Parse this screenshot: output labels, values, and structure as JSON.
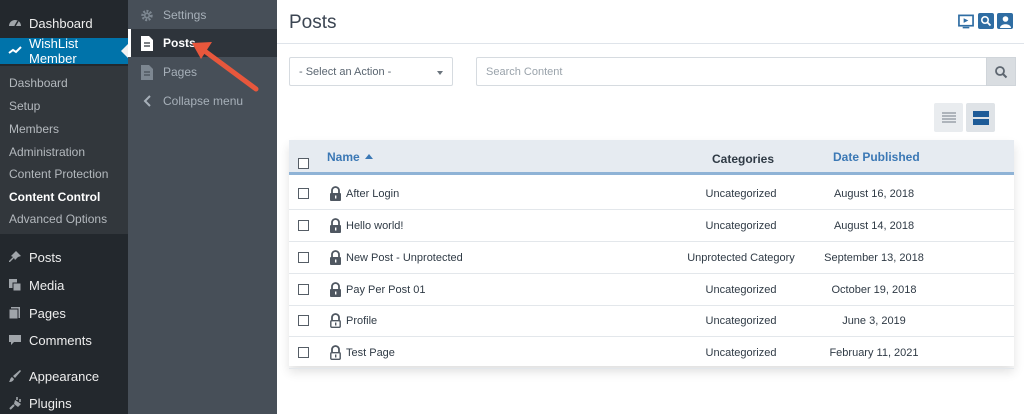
{
  "wp_menu": {
    "items_top": [
      {
        "label": "Dashboard",
        "icon": "dashboard-icon"
      },
      {
        "label": "WishList Member",
        "icon": "wishlist-check-icon"
      }
    ],
    "submenu": [
      "Dashboard",
      "Setup",
      "Members",
      "Administration",
      "Content Protection",
      "Content Control",
      "Advanced Options"
    ],
    "items_bottom": [
      {
        "label": "Posts",
        "icon": "pin-icon"
      },
      {
        "label": "Media",
        "icon": "media-icon"
      },
      {
        "label": "Pages",
        "icon": "pages-icon"
      },
      {
        "label": "Comments",
        "icon": "comment-icon"
      },
      {
        "label": "Appearance",
        "icon": "brush-icon"
      },
      {
        "label": "Plugins",
        "icon": "plug-icon"
      }
    ]
  },
  "flyout": {
    "items": [
      {
        "label": "Settings",
        "icon": "gear-icon"
      },
      {
        "label": "Posts",
        "icon": "document-icon"
      },
      {
        "label": "Pages",
        "icon": "document-icon"
      },
      {
        "label": "Collapse menu",
        "icon": "chevron-left-icon"
      }
    ]
  },
  "main": {
    "title": "Posts",
    "header_icons": [
      "video-icon",
      "search-help-icon",
      "user-icon"
    ],
    "action_select": "- Select an Action -",
    "search_placeholder": "Search Content",
    "view_buttons": [
      "list-view-icon",
      "grid-view-icon"
    ]
  },
  "table": {
    "headers": {
      "name": "Name",
      "categories": "Categories",
      "date": "Date Published"
    },
    "rows": [
      {
        "name": "After Login",
        "category": "Uncategorized",
        "date": "August 16, 2018",
        "lock": "locked"
      },
      {
        "name": "Hello world!",
        "category": "Uncategorized",
        "date": "August 14, 2018",
        "lock": "locked"
      },
      {
        "name": "New Post - Unprotected",
        "category": "Unprotected Category",
        "date": "September 13, 2018",
        "lock": "locked"
      },
      {
        "name": "Pay Per Post 01",
        "category": "Uncategorized",
        "date": "October 19, 2018",
        "lock": "locked"
      },
      {
        "name": "Profile",
        "category": "Uncategorized",
        "date": "June 3, 2019",
        "lock": "unlocked"
      },
      {
        "name": "Test Page",
        "category": "Uncategorized",
        "date": "February 11, 2021",
        "lock": "unlocked"
      }
    ]
  },
  "colors": {
    "sidebar": "#23282d",
    "active": "#0073aa",
    "flyout": "#474f58",
    "link": "#3b78b5",
    "annotation_arrow": "#e8573c"
  }
}
